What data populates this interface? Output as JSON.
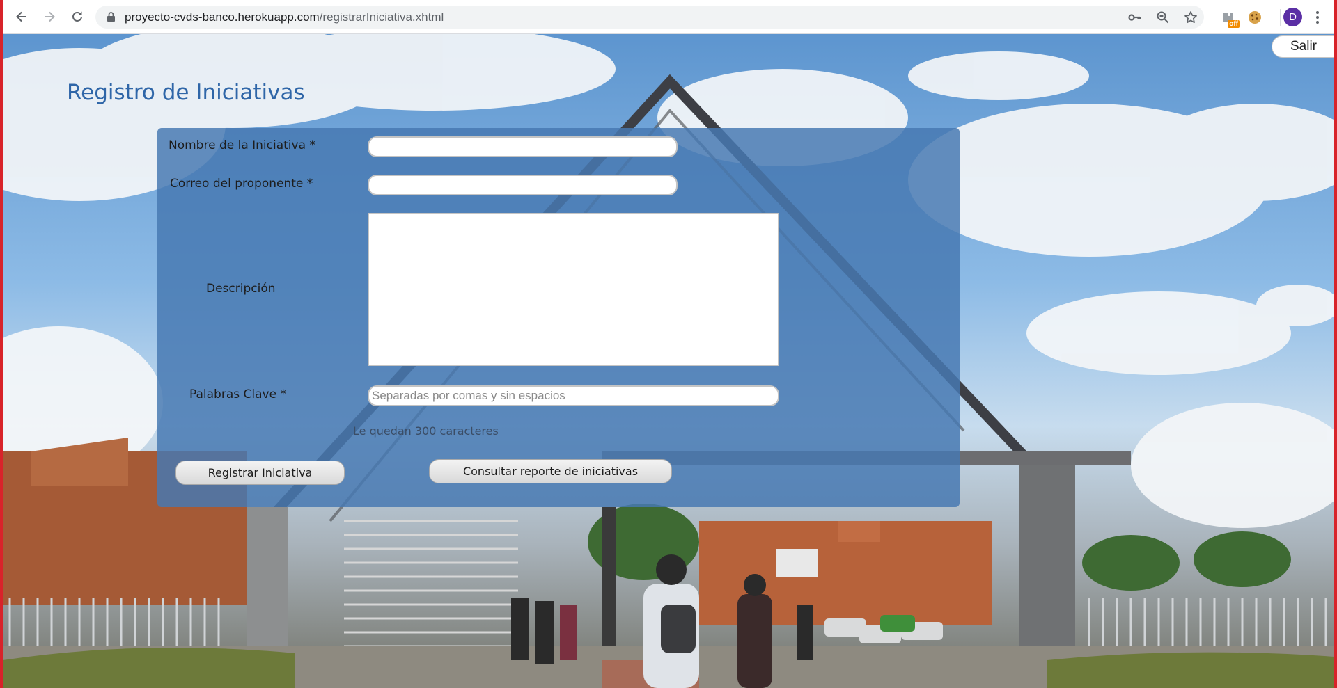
{
  "browser": {
    "url_host": "proyecto-cvds-banco.herokuapp.com",
    "url_path": "/registrarIniciativa.xhtml",
    "extension_badge": "off",
    "profile_initial": "D"
  },
  "header": {
    "logout_label": "Salir"
  },
  "form": {
    "title": "Registro de Iniciativas",
    "name_label": "Nombre de la Iniciativa *",
    "name_value": "",
    "email_label": "Correo del proponente *",
    "email_value": "",
    "description_label": "Descripción",
    "description_value": "",
    "keywords_label": "Palabras Clave *",
    "keywords_placeholder": "Separadas por comas y sin espacios",
    "counter_text": "Le quedan 300 caracteres",
    "submit_label": "Registrar Iniciativa",
    "report_label": "Consultar reporte de iniciativas"
  },
  "colors": {
    "title": "#2f66a8",
    "panel": "#4678b2",
    "window_border": "#d8232a",
    "avatar": "#5b2fa5"
  },
  "icons": [
    "back-icon",
    "forward-icon",
    "reload-icon",
    "lock-icon",
    "key-icon",
    "zoom-icon",
    "star-icon",
    "extension-icon",
    "cookie-icon",
    "menu-icon"
  ]
}
